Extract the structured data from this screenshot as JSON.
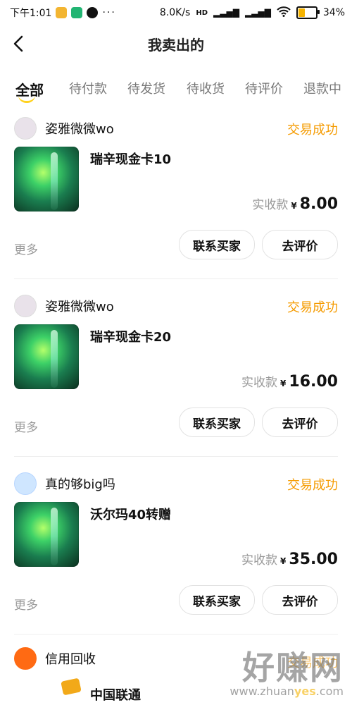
{
  "status_bar": {
    "time": "下午1:01",
    "dots": "···",
    "net_speed": "8.0K/s",
    "hd": "HD",
    "battery": "34%"
  },
  "header": {
    "title": "我卖出的",
    "back_icon": "back-chevron-icon"
  },
  "tabs": [
    "全部",
    "待付款",
    "待发货",
    "待收货",
    "待评价",
    "退款中"
  ],
  "orders": [
    {
      "seller": "姿雅微微wo",
      "status": "交易成功",
      "product": "瑞辛现金卡10",
      "price_label": "实收款",
      "currency": "¥",
      "amount": "8.00",
      "more": "更多",
      "btn_contact": "联系买家",
      "btn_review": "去评价"
    },
    {
      "seller": "姿雅微微wo",
      "status": "交易成功",
      "product": "瑞辛现金卡20",
      "price_label": "实收款",
      "currency": "¥",
      "amount": "16.00",
      "more": "更多",
      "btn_contact": "联系买家",
      "btn_review": "去评价"
    },
    {
      "seller": "真的够big吗",
      "status": "交易成功",
      "product": "沃尔玛40转赠",
      "price_label": "实收款",
      "currency": "¥",
      "amount": "35.00",
      "more": "更多",
      "btn_contact": "联系买家",
      "btn_review": "去评价"
    }
  ],
  "partial_order": {
    "seller": "信用回收",
    "status": "交易成功",
    "product": "中国联通"
  },
  "watermark": {
    "big": "好赚网",
    "small_prefix": "www.zhuan",
    "small_highlight": "yes",
    "small_suffix": ".com"
  },
  "colors": {
    "accent": "#f59b00",
    "tab_underline": "#ffd21f"
  }
}
